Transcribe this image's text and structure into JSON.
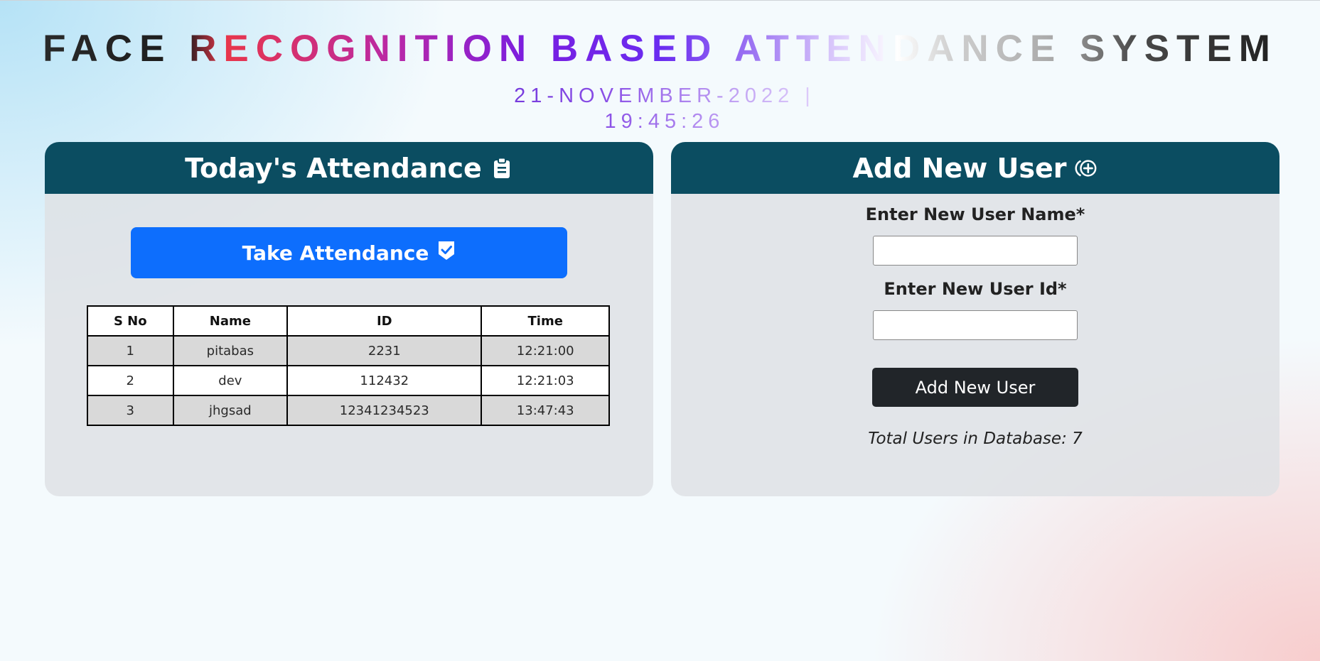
{
  "page": {
    "title": "FACE RECOGNITION BASED ATTENDANCE SYSTEM",
    "datetime": "21-NOVEMBER-2022 | 19:45:26"
  },
  "attendance_panel": {
    "title": "Today's Attendance",
    "title_icon": "clipboard-icon",
    "take_button_label": "Take Attendance",
    "take_button_icon": "shield-check-icon",
    "table": {
      "headers": [
        "S No",
        "Name",
        "ID",
        "Time"
      ],
      "rows": [
        [
          "1",
          "pitabas",
          "2231",
          "12:21:00"
        ],
        [
          "2",
          "dev",
          "112432",
          "12:21:03"
        ],
        [
          "3",
          "jhgsad",
          "12341234523",
          "13:47:43"
        ]
      ]
    }
  },
  "add_user_panel": {
    "title": "Add New User",
    "title_icon": "plus-circle-icon",
    "name_label": "Enter New User Name*",
    "name_value": "",
    "id_label": "Enter New User Id*",
    "id_value": "",
    "submit_label": "Add New User",
    "total_users_text": "Total Users in Database: 7"
  },
  "colors": {
    "header_bg": "#0b4d61",
    "primary_button": "#0d6efd",
    "dark_button": "#212529"
  }
}
